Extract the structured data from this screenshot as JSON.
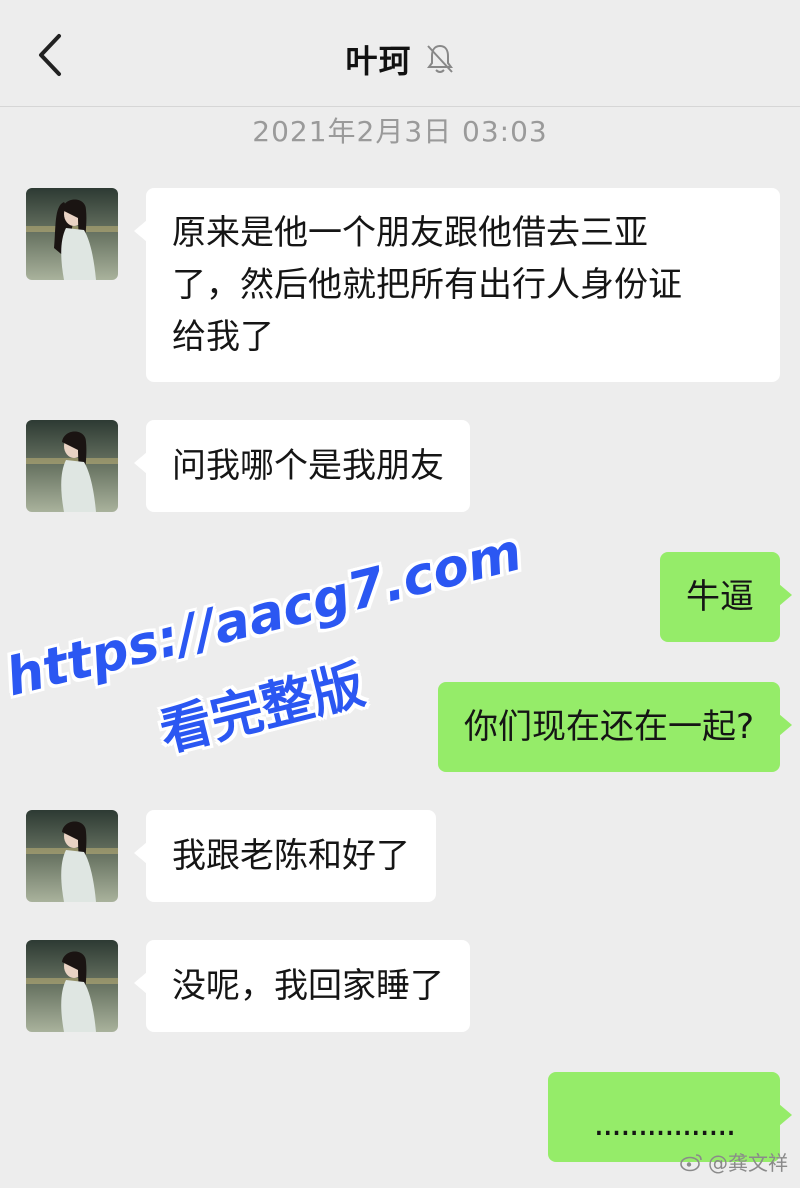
{
  "header": {
    "back_icon": "chevron-left-icon",
    "contact_name": "叶珂",
    "mute_icon": "bell-muted-icon"
  },
  "timestamp": "2021年2月3日 03:03",
  "messages": [
    {
      "side": "in",
      "text_lines": [
        "原来是他一个朋友跟他借去三亚",
        "了，然后他就把所有出行人身份证",
        "给我了"
      ]
    },
    {
      "side": "in",
      "text": "问我哪个是我朋友"
    },
    {
      "side": "out",
      "text": "牛逼"
    },
    {
      "side": "out",
      "text": "你们现在还在一起?"
    },
    {
      "side": "in",
      "text": "我跟老陈和好了"
    },
    {
      "side": "in",
      "text": "没呢，我回家睡了"
    },
    {
      "side": "out",
      "text": "................"
    }
  ],
  "watermark": {
    "line1": "https://aacg7.com",
    "line2": "看完整版",
    "color": "#2b57f2"
  },
  "source_tag": {
    "icon": "weibo-icon",
    "text": "@龚文祥"
  },
  "colors": {
    "background": "#ededed",
    "incoming_bubble": "#ffffff",
    "outgoing_bubble": "#95ec69",
    "timestamp": "#9a9a9a"
  }
}
